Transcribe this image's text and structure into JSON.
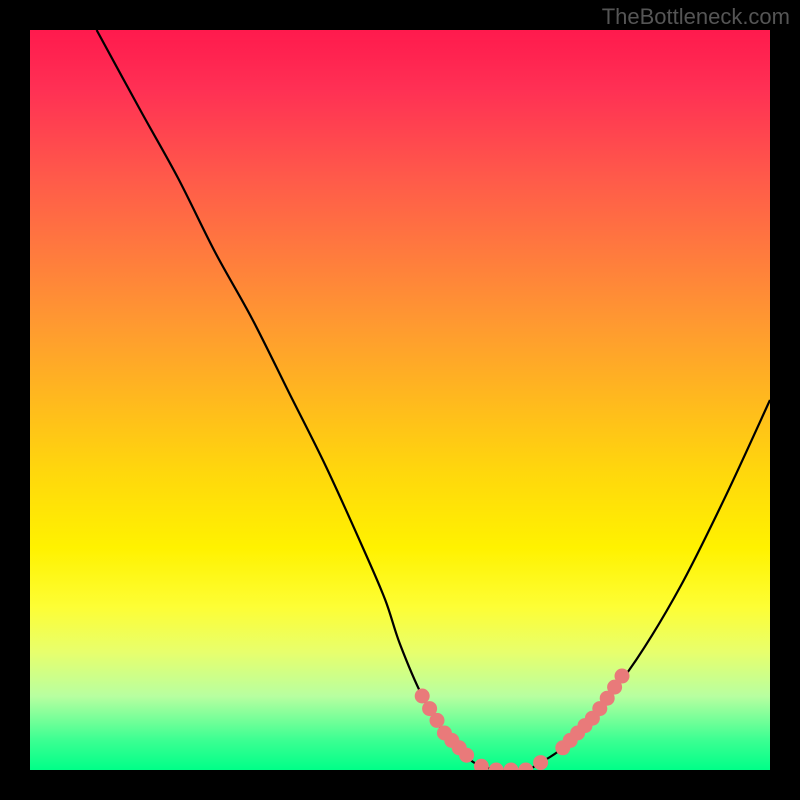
{
  "watermark": "TheBottleneck.com",
  "chart_data": {
    "type": "line",
    "title": "",
    "xlabel": "",
    "ylabel": "",
    "xlim": [
      0,
      100
    ],
    "ylim": [
      0,
      100
    ],
    "series": [
      {
        "name": "curve",
        "x": [
          9,
          15,
          20,
          25,
          30,
          35,
          40,
          45,
          48,
          50,
          53,
          56,
          60,
          64,
          67,
          69,
          72,
          76,
          82,
          88,
          94,
          100
        ],
        "y": [
          100,
          89,
          80,
          70,
          61,
          51,
          41,
          30,
          23,
          17,
          10,
          5,
          1,
          0,
          0,
          1,
          3,
          7,
          15,
          25,
          37,
          50
        ]
      }
    ],
    "markers": [
      {
        "name": "dots-left",
        "x": [
          53,
          54,
          55,
          56,
          57,
          58,
          59
        ],
        "y": [
          10,
          8.3,
          6.7,
          5,
          4,
          3,
          2
        ]
      },
      {
        "name": "dots-bottom",
        "x": [
          61,
          63,
          65,
          67,
          69
        ],
        "y": [
          0.5,
          0,
          0,
          0,
          1
        ]
      },
      {
        "name": "dots-right",
        "x": [
          72,
          73,
          74,
          75,
          76,
          77,
          78,
          79,
          80
        ],
        "y": [
          3,
          4,
          5,
          6,
          7,
          8.3,
          9.7,
          11.2,
          12.7
        ]
      }
    ],
    "colors": {
      "curve": "#000000",
      "markers": "#e97a7a"
    }
  }
}
